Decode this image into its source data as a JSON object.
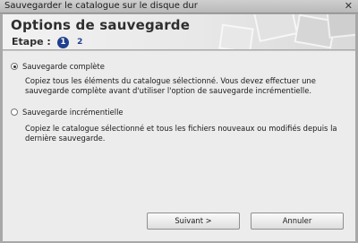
{
  "window": {
    "title": "Sauvegarder le catalogue sur le disque dur",
    "close_glyph": "✕"
  },
  "header": {
    "title": "Options de sauvegarde",
    "step_label": "Etape :",
    "steps": [
      "1",
      "2"
    ],
    "current_step": "1"
  },
  "options": [
    {
      "label": "Sauvegarde complète",
      "selected": true,
      "description": "Copiez tous les éléments du catalogue sélectionné. Vous devez effectuer une sauvegarde complète avant d'utiliser l'option de sauvegarde incrémentielle."
    },
    {
      "label": "Sauvegarde incrémentielle",
      "selected": false,
      "description": "Copiez le catalogue sélectionné et tous les fichiers nouveaux ou modifiés depuis la dernière sauvegarde."
    }
  ],
  "buttons": {
    "next": "Suivant >",
    "cancel": "Annuler"
  },
  "colors": {
    "accent": "#1f3f8f",
    "titlebar": "#c4c4c4",
    "content_bg": "#ececec",
    "frame": "#a8a8a8"
  },
  "icons": [
    "close-icon",
    "radio-checked-icon",
    "radio-unchecked-icon"
  ]
}
